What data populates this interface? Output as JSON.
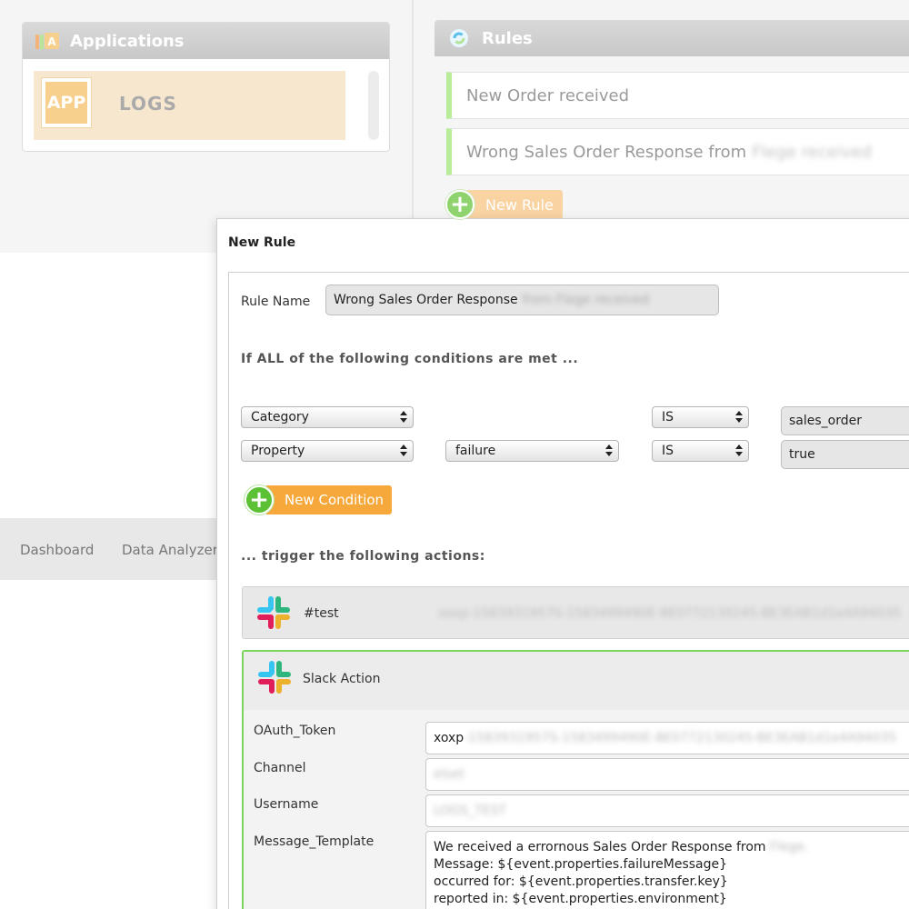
{
  "applications": {
    "title": "Applications",
    "app_badge": "APP",
    "app_name": "LOGS"
  },
  "rules": {
    "title": "Rules",
    "items": [
      {
        "label": "New Order received",
        "hidden_suffix": ""
      },
      {
        "label": "Wrong Sales Order Response from",
        "hidden_suffix": "Flege received"
      }
    ],
    "new_rule_label": "New Rule"
  },
  "nav": {
    "items": [
      "Dashboard",
      "Data Analyzer"
    ]
  },
  "dialog": {
    "title": "New Rule",
    "rule_name_label": "Rule Name",
    "rule_name_value": "Wrong Sales Order Response",
    "rule_name_hidden": "from Flege received",
    "conditions_heading": "If ALL of the following conditions are met ...",
    "conditions": [
      {
        "field": "Category",
        "sub": "",
        "operator": "IS",
        "value": "sales_order"
      },
      {
        "field": "Property",
        "sub": "failure",
        "operator": "IS",
        "value": "true"
      }
    ],
    "new_condition_label": "New Condition",
    "actions_heading": "... trigger the following actions:",
    "collapsed_action": {
      "channel": "#test",
      "hidden_token": "xoxp-1583931957S-1583499490E-8E0772130245-BE3EAB1d1e4A94035"
    },
    "slack_action": {
      "title": "Slack Action",
      "oauth_label": "OAuth_Token",
      "oauth_value_visible": "xoxp",
      "oauth_value_hidden": "-1583931957S-1583499490E-8E0772130245-BE3EAB1d1e4A94035",
      "channel_label": "Channel",
      "channel_hidden": "elset",
      "username_label": "Username",
      "username_hidden": "LOGS_TEST",
      "template_label": "Message_Template",
      "template_line1": "We received a errornous Sales Order Response from",
      "template_line1_hidden": "Flege.",
      "template_line2": "Message: ${event.properties.failureMessage}",
      "template_line3": "occurred for: ${event.properties.transfer.key}",
      "template_line4": "reported in: ${event.properties.environment}"
    }
  },
  "colors": {
    "accent_orange": "#f6a83b",
    "accent_green": "#5cc134",
    "rule_border": "#b8ee9a"
  }
}
